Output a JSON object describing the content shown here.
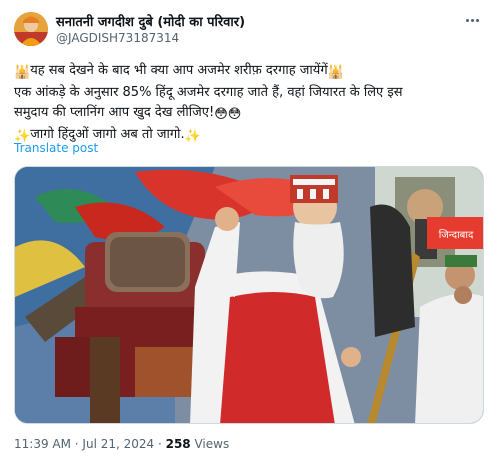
{
  "author": {
    "display_name": "सनातनी जगदीश दुबे (मोदी का परिवार)",
    "handle": "@JAGDISH73187314",
    "avatar_icon": "profile-avatar"
  },
  "tweet": {
    "lines": [
      "यह सब देखने के बाद भी क्या आप अजमेर शरीफ़ दरगाह जायेंगें",
      "एक आंकड़े के अनुसार 85% हिंदू अजमेर दरगाह जाते हैं, वहां जियारत के लिए इस",
      "समुदाय की प्लानिंग आप खुद देख लीजिए!",
      "जागो हिंदुओं जागो अब तो जागो."
    ],
    "emoji": {
      "mosque": "🕌",
      "flushed": "😳",
      "sparkles": "✨"
    }
  },
  "translate_label": "Translate post",
  "media": {
    "banner_text": "जिन्दाबाद",
    "description_icon": "video-thumbnail"
  },
  "meta": {
    "time": "11:39 AM",
    "separator": " · ",
    "date": "Jul 21, 2024",
    "views_count": "258",
    "views_label": " Views"
  },
  "colors": {
    "link": "#1d9bf0",
    "secondary_text": "#536471",
    "primary_text": "#0f1419",
    "border": "#cfd9de"
  }
}
